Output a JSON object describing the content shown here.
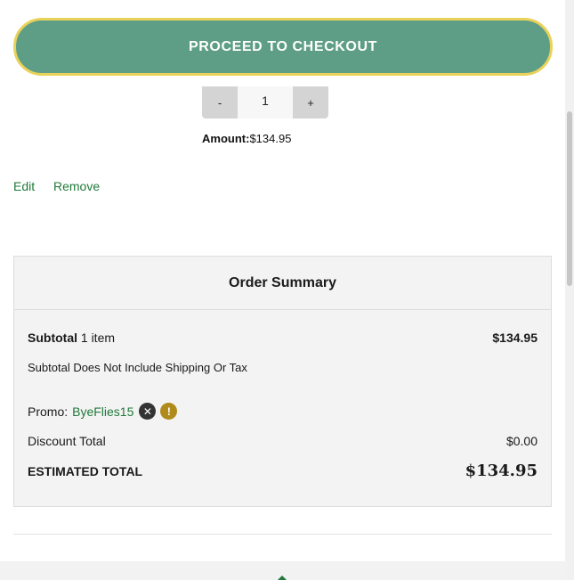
{
  "checkout": {
    "button_label": "PROCEED TO CHECKOUT"
  },
  "cart_item": {
    "qty_minus": "-",
    "qty_value": "1",
    "qty_plus": "+",
    "amount_label": "Amount:",
    "amount_value": "$134.95",
    "edit_label": "Edit",
    "remove_label": "Remove"
  },
  "order_summary": {
    "title": "Order Summary",
    "subtotal_label": "Subtotal",
    "subtotal_items": " 1 item",
    "subtotal_value": "$134.95",
    "note": "Subtotal Does Not Include Shipping Or Tax",
    "promo_label": "Promo:",
    "promo_code": "ByeFlies15",
    "promo_remove_icon": "✕",
    "promo_alert_icon": "!",
    "discount_label": "Discount Total",
    "discount_value": "$0.00",
    "total_label": "ESTIMATED TOTAL",
    "total_value": "$134.95"
  },
  "colors": {
    "checkout_bg": "#5f9e86",
    "checkout_border": "#e9d25a",
    "link": "#1f7a3a",
    "promo_alert": "#b08a1a"
  },
  "icons": {
    "promo_remove": "close-circle-icon",
    "promo_alert": "alert-circle-icon",
    "footer": "chevron-up-icon"
  }
}
